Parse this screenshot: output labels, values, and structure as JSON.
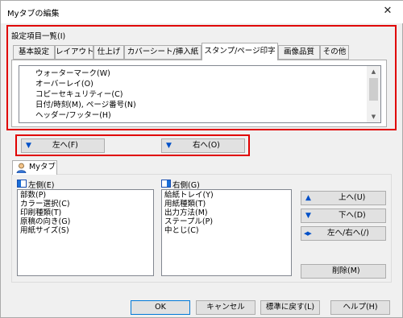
{
  "window": {
    "title": "Myタブの編集",
    "close_glyph": "✕"
  },
  "settings_list_label": "設定項目一覧(I)",
  "tabs": [
    {
      "label": "基本設定"
    },
    {
      "label": "レイアウト"
    },
    {
      "label": "仕上げ"
    },
    {
      "label": "カバーシート/挿入紙"
    },
    {
      "label": "スタンプ/ページ印字",
      "active": true
    },
    {
      "label": "画像品質"
    },
    {
      "label": "その他"
    }
  ],
  "settings_items": [
    "ウォーターマーク(W)",
    "オーバーレイ(O)",
    "コピーセキュリティー(C)",
    "日付/時刻(M), ページ番号(N)",
    "ヘッダー/フッター(H)"
  ],
  "move_buttons": {
    "left": "左へ(F)",
    "right": "右へ(O)"
  },
  "mytab": {
    "tab_label": "Myタブ",
    "left_label": "左側(E)",
    "right_label": "右側(G)",
    "left_items": [
      "部数(P)",
      "カラー選択(C)",
      "印刷種類(T)",
      "原稿の向き(G)",
      "用紙サイズ(S)"
    ],
    "right_items": [
      "給紙トレイ(Y)",
      "用紙種類(T)",
      "出力方法(M)",
      "ステープル(P)",
      "中とじ(C)"
    ],
    "up": "上へ(U)",
    "down": "下へ(D)",
    "leftright": "左へ/右へ(/)",
    "delete": "削除(M)"
  },
  "footer": {
    "ok": "OK",
    "cancel": "キャンセル",
    "reset": "標準に戻す(L)",
    "help": "ヘルプ(H)"
  },
  "icons": {
    "up_arrow": "▲",
    "down_arrow": "▼",
    "leftright_arrow": "◀▶",
    "scroll_up": "▲",
    "scroll_down": "▼"
  },
  "colors": {
    "highlight_box": "#e00000",
    "arrow_blue": "#0050c8",
    "dialog_bg": "#f0f0f0"
  }
}
